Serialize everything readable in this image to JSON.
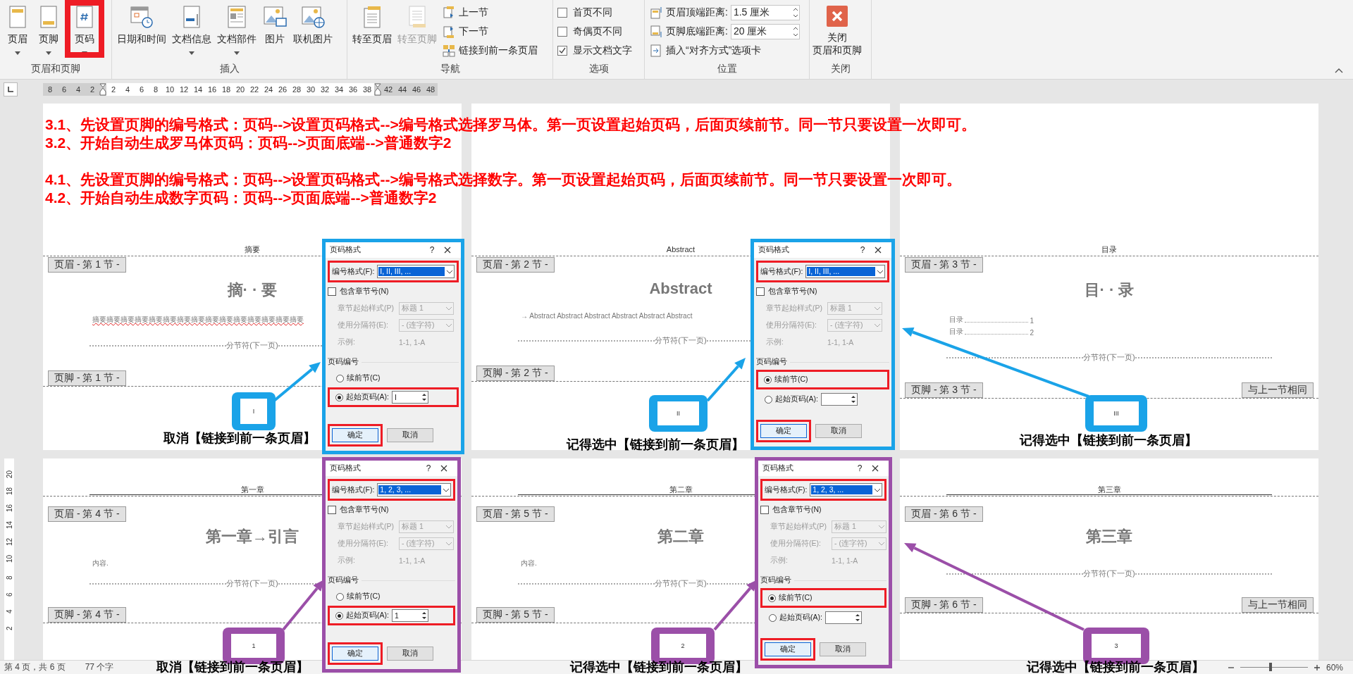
{
  "ribbon": {
    "groups": [
      {
        "label": "页眉和页脚",
        "buttons": [
          {
            "kind": "large",
            "label": "页眉",
            "dropdown": true,
            "highlighted": false
          },
          {
            "kind": "large",
            "label": "页脚",
            "dropdown": true,
            "highlighted": false
          },
          {
            "kind": "large",
            "label": "页码",
            "dropdown": true,
            "highlighted": true
          }
        ]
      },
      {
        "label": "插入",
        "buttons": [
          {
            "kind": "large",
            "label": "日期和时间",
            "dropdown": false,
            "highlighted": false
          },
          {
            "kind": "large",
            "label": "文档信息",
            "dropdown": true,
            "highlighted": false
          },
          {
            "kind": "large",
            "label": "文档部件",
            "dropdown": true,
            "highlighted": false
          },
          {
            "kind": "large",
            "label": "图片",
            "dropdown": false,
            "highlighted": false
          },
          {
            "kind": "large",
            "label": "联机图片",
            "dropdown": false,
            "highlighted": false
          }
        ]
      },
      {
        "label": "导航",
        "buttons": [
          {
            "kind": "large",
            "label": "转至页眉",
            "disabled": false
          },
          {
            "kind": "large",
            "label": "转至页脚",
            "disabled": true
          },
          {
            "kind": "small",
            "label": "上一节"
          },
          {
            "kind": "small",
            "label": "下一节"
          },
          {
            "kind": "small",
            "label": "链接到前一条页眉"
          }
        ]
      },
      {
        "label": "选项",
        "buttons": [
          {
            "kind": "check",
            "label": "首页不同",
            "checked": false
          },
          {
            "kind": "check",
            "label": "奇偶页不同",
            "checked": false
          },
          {
            "kind": "check",
            "label": "显示文档文字",
            "checked": true
          }
        ]
      },
      {
        "label": "位置",
        "buttons": [
          {
            "kind": "spin",
            "label": "页眉顶端距离:",
            "value": "1.5 厘米"
          },
          {
            "kind": "spin",
            "label": "页脚底端距离:",
            "value": "20 厘米"
          },
          {
            "kind": "small",
            "label": "插入“对齐方式”选项卡"
          }
        ]
      },
      {
        "label": "关闭",
        "buttons": [
          {
            "kind": "close",
            "lines": [
              "关闭",
              "页眉和页脚"
            ]
          }
        ]
      }
    ]
  },
  "ruler": {
    "numbers": [
      "8",
      "6",
      "4",
      "2",
      "2",
      "4",
      "6",
      "8",
      "10",
      "12",
      "14",
      "16",
      "18",
      "20",
      "22",
      "24",
      "26",
      "28",
      "30",
      "32",
      "34",
      "36",
      "38",
      "42",
      "44",
      "46",
      "48"
    ]
  },
  "vertical_ruler": {
    "numbers": [
      "20",
      "18",
      "16",
      "14",
      "12",
      "10",
      "8",
      "6",
      "4",
      "2"
    ]
  },
  "instructions": [
    "3.1、先设置页脚的编号格式：页码-->设置页码格式-->编号格式选择罗马体。第一页设置起始页码，后面页续前节。同一节只要设置一次即可。",
    "3.2、开始自动生成罗马体页码：页码-->页面底端-->普通数字2",
    "4.1、先设置页脚的编号格式：页码-->设置页码格式-->编号格式选择数字。第一页设置起始页码，后面页续前节。同一节只要设置一次即可。",
    "4.2、开始自动生成数字页码：页码-->页面底端-->普通数字2"
  ],
  "pages": [
    {
      "header_text": "摘要",
      "header_tag": "页眉 - 第 1 节 -",
      "title": "摘· · 要",
      "body": [
        {
          "kind": "misspelled",
          "text": "摘要摘要摘要摘要摘要摘要摘要摘要摘要摘要摘要摘要摘要摘要摘要"
        }
      ],
      "section_break": "分节符(下一页)",
      "footer_tag": "页脚 - 第 1 节 -"
    },
    {
      "header_text": "Abstract",
      "header_tag": "页眉 - 第 2 节 -",
      "title": "Abstract",
      "body": [
        {
          "kind": "text",
          "text": "→ Abstract Abstract Abstract Abstract Abstract Abstract"
        }
      ],
      "section_break": "分节符(下一页)",
      "footer_tag": "页脚 - 第 2 节 -"
    },
    {
      "header_text": "目录",
      "header_tag": "页眉 - 第 3 节 -",
      "title": "目· · 录",
      "body": [
        {
          "kind": "toc",
          "text": "目录",
          "page": "1"
        },
        {
          "kind": "toc",
          "text": "目录",
          "page": "2"
        }
      ],
      "section_break": "分节符(下一页)",
      "footer_tag": "页脚 - 第 3 节 -",
      "footer_link": "与上一节相同"
    },
    {
      "header_text": "第一章",
      "header_tag": "页眉 - 第 4 节 -",
      "title": "第一章→引言",
      "body": [
        {
          "kind": "text",
          "text": "内容."
        }
      ],
      "section_break": "分节符(下一页)",
      "footer_tag": "页脚 - 第 4 节 -"
    },
    {
      "header_text": "第二章",
      "header_tag": "页眉 - 第 5 节 -",
      "title": "第二章",
      "body": [
        {
          "kind": "text",
          "text": "内容."
        }
      ],
      "section_break": "分节符(下一页)",
      "footer_tag": "页脚 - 第 5 节 -"
    },
    {
      "header_text": "第三章",
      "header_tag": "页眉 - 第 6 节 -",
      "title": "第三章",
      "section_break": "分节符(下一页)",
      "footer_tag": "页脚 - 第 6 节 -",
      "footer_link": "与上一节相同"
    }
  ],
  "annotations": [
    {
      "color": "#1aa3e8",
      "page_number": "I",
      "caption": "取消【链接到前一条页眉】"
    },
    {
      "color": "#1aa3e8",
      "page_number": "II",
      "caption": "记得选中【链接到前一条页眉】"
    },
    {
      "color": "#1aa3e8",
      "page_number": "III",
      "caption": "记得选中【链接到前一条页眉】"
    },
    {
      "color": "#9b4fa8",
      "page_number": "1",
      "caption": "取消【链接到前一条页眉】"
    },
    {
      "color": "#9b4fa8",
      "page_number": "2",
      "caption": "记得选中【链接到前一条页眉】"
    },
    {
      "color": "#9b4fa8",
      "page_number": "3",
      "caption": "记得选中【链接到前一条页眉】"
    }
  ],
  "dialogs": [
    {
      "color": "#1aa3e8",
      "title": "页码格式",
      "help": "?",
      "format_label": "编号格式(F):",
      "format_value": "I, II, III, ...",
      "include_chapter": {
        "label": "包含章节号(N)",
        "checked": false
      },
      "chapter_style": {
        "label": "章节起始样式(P)",
        "value": "标题 1"
      },
      "separator": {
        "label": "使用分隔符(E):",
        "value": "-  (连字符)"
      },
      "example": {
        "label": "示例:",
        "value": "1-1, 1-A"
      },
      "numbering_heading": "页码编号",
      "continue": {
        "label": "续前节(C)",
        "selected": false
      },
      "start": {
        "label": "起始页码(A):",
        "selected": true,
        "value": "I"
      },
      "ok": "确定",
      "cancel": "取消"
    },
    {
      "color": "#1aa3e8",
      "title": "页码格式",
      "help": "?",
      "format_label": "编号格式(F):",
      "format_value": "I, II, III, ...",
      "include_chapter": {
        "label": "包含章节号(N)",
        "checked": false
      },
      "chapter_style": {
        "label": "章节起始样式(P)",
        "value": "标题 1"
      },
      "separator": {
        "label": "使用分隔符(E):",
        "value": "-  (连字符)"
      },
      "example": {
        "label": "示例:",
        "value": "1-1, 1-A"
      },
      "numbering_heading": "页码编号",
      "continue": {
        "label": "续前节(C)",
        "selected": true
      },
      "start": {
        "label": "起始页码(A):",
        "selected": false
      },
      "ok": "确定",
      "cancel": "取消"
    },
    {
      "color": "#9b4fa8",
      "title": "页码格式",
      "help": "?",
      "format_label": "编号格式(F):",
      "format_value": "1, 2, 3, ...",
      "include_chapter": {
        "label": "包含章节号(N)",
        "checked": false
      },
      "chapter_style": {
        "label": "章节起始样式(P)",
        "value": "标题 1"
      },
      "separator": {
        "label": "使用分隔符(E):",
        "value": "-  (连字符)"
      },
      "example": {
        "label": "示例:",
        "value": "1-1, 1-A"
      },
      "numbering_heading": "页码编号",
      "continue": {
        "label": "续前节(C)",
        "selected": false
      },
      "start": {
        "label": "起始页码(A):",
        "selected": true,
        "value": "1"
      },
      "ok": "确定",
      "cancel": "取消"
    },
    {
      "color": "#9b4fa8",
      "title": "页码格式",
      "help": "?",
      "format_label": "编号格式(F):",
      "format_value": "1, 2, 3, ...",
      "include_chapter": {
        "label": "包含章节号(N)",
        "checked": false
      },
      "chapter_style": {
        "label": "章节起始样式(P)",
        "value": "标题 1"
      },
      "separator": {
        "label": "使用分隔符(E):",
        "value": "-  (连字符)"
      },
      "example": {
        "label": "示例:",
        "value": "1-1, 1-A"
      },
      "numbering_heading": "页码编号",
      "continue": {
        "label": "续前节(C)",
        "selected": true
      },
      "start": {
        "label": "起始页码(A):",
        "selected": false
      },
      "ok": "确定",
      "cancel": "取消"
    }
  ],
  "status_bar": {
    "page": "第 4 页，共 6 页",
    "words": "77 个字",
    "zoom": "60%",
    "zoom_slider": {
      "level": 0.45
    }
  }
}
